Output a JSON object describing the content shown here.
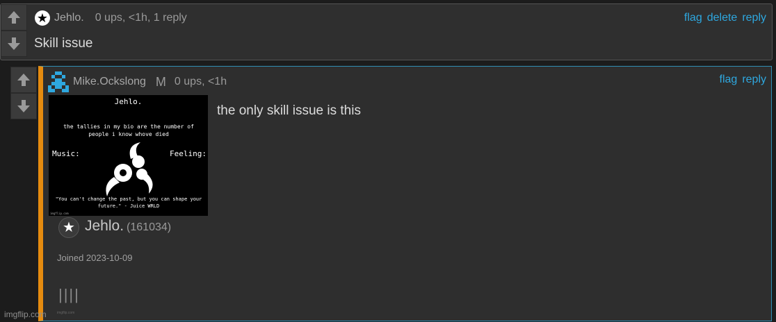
{
  "top_comment": {
    "username": "Jehlo.",
    "stats": "0 ups, <1h, 1 reply",
    "actions": [
      "flag",
      "delete",
      "reply"
    ],
    "text": "Skill issue"
  },
  "reply": {
    "username": "Mike.Ockslong",
    "mod_badge": "M",
    "stats": "0 ups, <1h",
    "actions": [
      "flag",
      "reply"
    ],
    "text": "the only skill issue is this",
    "image": {
      "title": "Jehlo.",
      "bio": "the tallies in my bio are the number of people i know whove died",
      "music_label": "Music:",
      "feeling_label": "Feeling:",
      "quote": "\"You can't change the past, but you can shape your future.\" - Juice WRLD",
      "watermark": "imgflip.com"
    },
    "profile": {
      "name": "Jehlo.",
      "id": "(161034)",
      "joined": "Joined 2023-10-09",
      "tallies": "||||",
      "watermark": "imgflip.com"
    }
  },
  "site_watermark": "imgflip.com",
  "colors": {
    "link": "#2ea8e0",
    "accent_bar": "#e58b0f",
    "reply_border": "#2f8fb6"
  }
}
